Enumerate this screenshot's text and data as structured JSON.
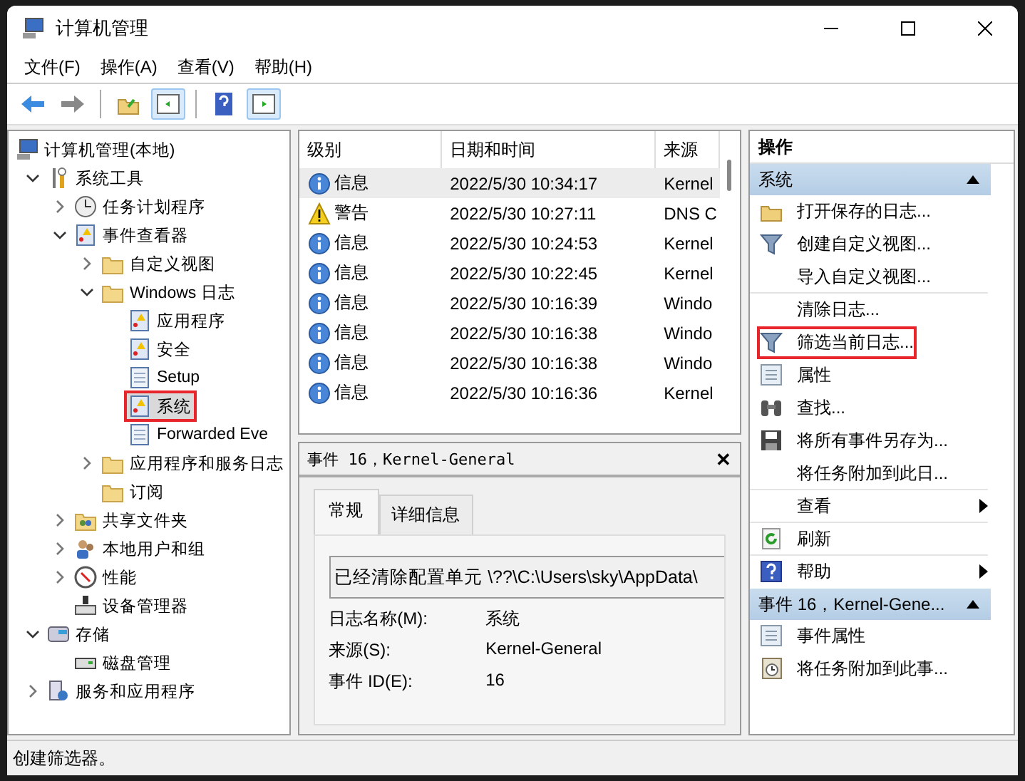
{
  "window": {
    "title": "计算机管理"
  },
  "menu": [
    {
      "label": "文件(F)"
    },
    {
      "label": "操作(A)"
    },
    {
      "label": "查看(V)"
    },
    {
      "label": "帮助(H)"
    }
  ],
  "tree": [
    {
      "label": "计算机管理(本地)",
      "kind": "computer",
      "selected": false,
      "marked": false,
      "children": [
        {
          "label": "系统工具",
          "kind": "tools",
          "expanded": true,
          "selected": false,
          "marked": false,
          "children": [
            {
              "label": "任务计划程序",
              "kind": "clock",
              "expanded": false,
              "selected": false,
              "marked": false
            },
            {
              "label": "事件查看器",
              "kind": "viewer",
              "expanded": true,
              "selected": false,
              "marked": false,
              "children": [
                {
                  "label": "自定义视图",
                  "kind": "folder",
                  "expanded": false,
                  "selected": false,
                  "marked": false
                },
                {
                  "label": "Windows 日志",
                  "kind": "folder",
                  "expanded": true,
                  "selected": false,
                  "marked": false,
                  "children": [
                    {
                      "label": "应用程序",
                      "kind": "log",
                      "selected": false,
                      "marked": false
                    },
                    {
                      "label": "安全",
                      "kind": "log",
                      "selected": false,
                      "marked": false
                    },
                    {
                      "label": "Setup",
                      "kind": "doc",
                      "selected": false,
                      "marked": false
                    },
                    {
                      "label": "系统",
                      "kind": "log",
                      "selected": true,
                      "marked": true
                    },
                    {
                      "label": "Forwarded Eve",
                      "kind": "doc",
                      "selected": false,
                      "marked": false
                    }
                  ]
                },
                {
                  "label": "应用程序和服务日志",
                  "kind": "folder",
                  "expanded": false,
                  "selected": false,
                  "marked": false
                },
                {
                  "label": "订阅",
                  "kind": "folder",
                  "selected": false,
                  "marked": false
                }
              ]
            },
            {
              "label": "共享文件夹",
              "kind": "share",
              "expanded": false,
              "selected": false,
              "marked": false
            },
            {
              "label": "本地用户和组",
              "kind": "users",
              "expanded": false,
              "selected": false,
              "marked": false
            },
            {
              "label": "性能",
              "kind": "gauge",
              "expanded": false,
              "selected": false,
              "marked": false
            },
            {
              "label": "设备管理器",
              "kind": "device",
              "selected": false,
              "marked": false
            }
          ]
        },
        {
          "label": "存储",
          "kind": "storage",
          "expanded": true,
          "selected": false,
          "marked": false,
          "children": [
            {
              "label": "磁盘管理",
              "kind": "disk",
              "selected": false,
              "marked": false
            }
          ]
        },
        {
          "label": "服务和应用程序",
          "kind": "services",
          "expanded": false,
          "selected": false,
          "marked": false
        }
      ]
    }
  ],
  "events": {
    "columns": [
      "级别",
      "日期和时间",
      "来源"
    ],
    "rows": [
      {
        "kind": "info",
        "level": "信息",
        "time": "2022/5/30 10:34:17",
        "source": "Kernel",
        "selected": true
      },
      {
        "kind": "warning",
        "level": "警告",
        "time": "2022/5/30 10:27:11",
        "source": "DNS C",
        "selected": false
      },
      {
        "kind": "info",
        "level": "信息",
        "time": "2022/5/30 10:24:53",
        "source": "Kernel",
        "selected": false
      },
      {
        "kind": "info",
        "level": "信息",
        "time": "2022/5/30 10:22:45",
        "source": "Kernel",
        "selected": false
      },
      {
        "kind": "info",
        "level": "信息",
        "time": "2022/5/30 10:16:39",
        "source": "Windo",
        "selected": false
      },
      {
        "kind": "info",
        "level": "信息",
        "time": "2022/5/30 10:16:38",
        "source": "Windo",
        "selected": false
      },
      {
        "kind": "info",
        "level": "信息",
        "time": "2022/5/30 10:16:38",
        "source": "Windo",
        "selected": false
      },
      {
        "kind": "info",
        "level": "信息",
        "time": "2022/5/30 10:16:36",
        "source": "Kernel",
        "selected": false
      }
    ]
  },
  "detail": {
    "title": "事件 16，Kernel-General",
    "close": "✕",
    "tabs": [
      {
        "label": "常规",
        "selected": true
      },
      {
        "label": "详细信息",
        "selected": false
      }
    ],
    "message": "已经清除配置单元 \\??\\C:\\Users\\sky\\AppData\\",
    "fields": [
      {
        "label": "日志名称(M):",
        "value": "系统"
      },
      {
        "label": "来源(S):",
        "value": "Kernel-General"
      },
      {
        "label": "事件 ID(E):",
        "value": "16"
      }
    ]
  },
  "actions": {
    "title": "操作",
    "groups": [
      {
        "title": "系统",
        "expanded": true,
        "items": [
          {
            "label": "打开保存的日志...",
            "kind": "open",
            "submenu": false,
            "separator": false,
            "marked": false
          },
          {
            "label": "创建自定义视图...",
            "kind": "filter",
            "submenu": false,
            "separator": false,
            "marked": false
          },
          {
            "label": "导入自定义视图...",
            "kind": "plain",
            "submenu": false,
            "separator": true,
            "marked": false
          },
          {
            "label": "清除日志...",
            "kind": "plain",
            "submenu": false,
            "separator": false,
            "marked": false
          },
          {
            "label": "筛选当前日志...",
            "kind": "filter",
            "submenu": false,
            "separator": false,
            "marked": true
          },
          {
            "label": "属性",
            "kind": "properties",
            "submenu": false,
            "separator": false,
            "marked": false
          },
          {
            "label": "查找...",
            "kind": "find",
            "submenu": false,
            "separator": false,
            "marked": false
          },
          {
            "label": "将所有事件另存为...",
            "kind": "save",
            "submenu": false,
            "separator": false,
            "marked": false
          },
          {
            "label": "将任务附加到此日...",
            "kind": "plain",
            "submenu": false,
            "separator": true,
            "marked": false
          },
          {
            "label": "查看",
            "kind": "plain",
            "submenu": true,
            "separator": true,
            "marked": false
          },
          {
            "label": "刷新",
            "kind": "refresh",
            "submenu": false,
            "separator": true,
            "marked": false
          },
          {
            "label": "帮助",
            "kind": "help",
            "submenu": true,
            "separator": false,
            "marked": false
          }
        ]
      },
      {
        "title": "事件 16，Kernel-Gene...",
        "expanded": true,
        "items": [
          {
            "label": "事件属性",
            "kind": "properties",
            "submenu": false,
            "separator": false,
            "marked": false
          },
          {
            "label": "将任务附加到此事...",
            "kind": "task",
            "submenu": false,
            "separator": false,
            "marked": false
          }
        ]
      }
    ]
  },
  "status_bar": "创建筛选器。"
}
